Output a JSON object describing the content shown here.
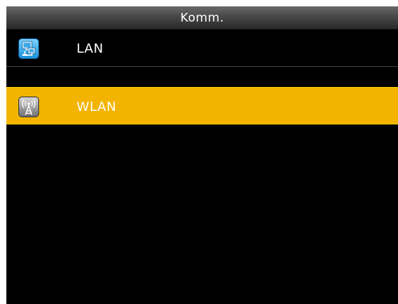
{
  "header": {
    "title": "Komm."
  },
  "menu": {
    "items": [
      {
        "label": "LAN",
        "icon": "network-computers-icon",
        "selected": false
      },
      {
        "label": "WLAN",
        "icon": "wireless-tower-icon",
        "selected": true
      }
    ]
  },
  "colors": {
    "background": "#000000",
    "selected": "#f3b400",
    "text": "#ffffff"
  }
}
